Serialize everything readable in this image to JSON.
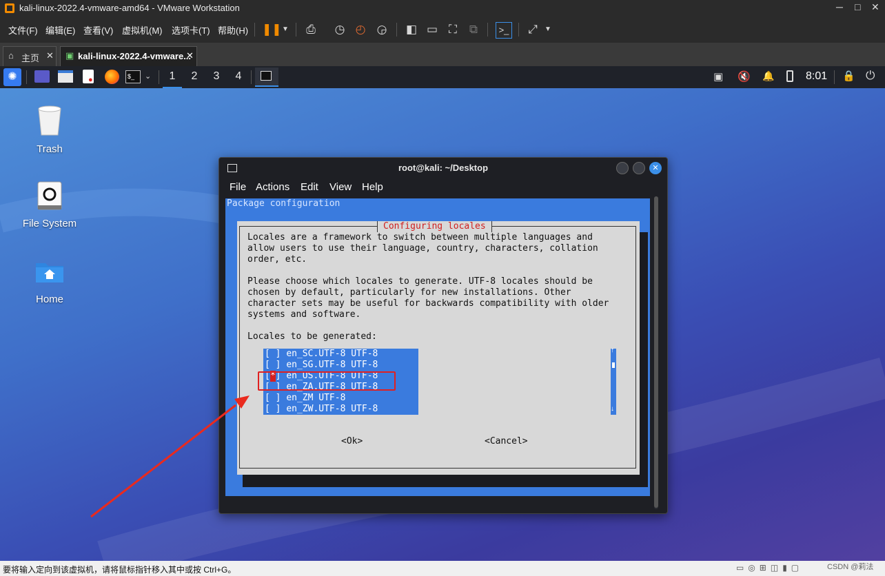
{
  "window": {
    "title": "kali-linux-2022.4-vmware-amd64 - VMware Workstation"
  },
  "vm_menu": [
    "文件(F)",
    "编辑(E)",
    "查看(V)",
    "虚拟机(M)",
    "选项卡(T)",
    "帮助(H)"
  ],
  "tabs": [
    {
      "label": "主页",
      "active": false
    },
    {
      "label": "kali-linux-2022.4-vmware...",
      "active": true
    }
  ],
  "panel": {
    "workspaces": [
      "1",
      "2",
      "3",
      "4"
    ],
    "clock": "8:01"
  },
  "desktop_icons": [
    {
      "label": "Trash",
      "icon": "trash-icon"
    },
    {
      "label": "File System",
      "icon": "drive-icon"
    },
    {
      "label": "Home",
      "icon": "home-folder-icon"
    }
  ],
  "terminal": {
    "title": "root@kali: ~/Desktop",
    "menu": [
      "File",
      "Actions",
      "Edit",
      "View",
      "Help"
    ],
    "header": "Package configuration",
    "dialog_title": "Configuring locales",
    "paragraphs": [
      "Locales are a framework to switch between multiple languages and\nallow users to use their language, country, characters, collation\norder, etc.",
      "Please choose which locales to generate. UTF-8 locales should be\nchosen by default, particularly for new installations. Other\ncharacter sets may be useful for backwards compatibility with older\nsystems and software.",
      "Locales to be generated:"
    ],
    "locales": [
      {
        "box": "[ ]",
        "name": "en_SC.UTF-8 UTF-8",
        "selected": false
      },
      {
        "box": "[ ]",
        "name": "en_SG.UTF-8 UTF-8",
        "selected": false
      },
      {
        "box": "[*]",
        "name": "en_US.UTF-8 UTF-8",
        "selected": true
      },
      {
        "box": "[ ]",
        "name": "en_ZA.UTF-8 UTF-8",
        "selected": false
      },
      {
        "box": "[ ]",
        "name": "en_ZM UTF-8",
        "selected": false
      },
      {
        "box": "[ ]",
        "name": "en_ZW.UTF-8 UTF-8",
        "selected": false
      }
    ],
    "ok_label": "<Ok>",
    "cancel_label": "<Cancel>"
  },
  "status_bar": {
    "hint": "要将输入定向到该虚拟机，请将鼠标指针移入其中或按 Ctrl+G。",
    "watermark": "CSDN @莉法"
  },
  "colors": {
    "dialog_blue": "#3a7bde",
    "dialog_gray": "#d8d8d8",
    "accent_red": "#e02020"
  }
}
